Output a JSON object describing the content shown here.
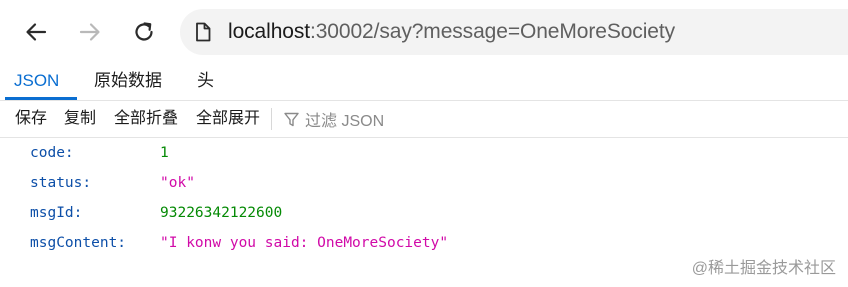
{
  "browser": {
    "back_icon": "arrow-left-icon",
    "forward_icon": "arrow-right-icon",
    "reload_icon": "reload-icon",
    "page_icon": "page-icon",
    "url_host": "localhost",
    "url_rest": ":30002/say?message=OneMoreSociety"
  },
  "viewer": {
    "tabs": [
      {
        "label": "JSON",
        "active": true
      },
      {
        "label": "原始数据",
        "active": false
      },
      {
        "label": "头",
        "active": false
      }
    ],
    "actions": {
      "save": "保存",
      "copy": "复制",
      "collapse_all": "全部折叠",
      "expand_all": "全部展开",
      "filter_placeholder": "过滤 JSON",
      "filter_icon": "filter-icon"
    },
    "rows": [
      {
        "key": "code:",
        "value": "1",
        "type": "number"
      },
      {
        "key": "status:",
        "value": "\"ok\"",
        "type": "string"
      },
      {
        "key": "msgId:",
        "value": "93226342122600",
        "type": "number"
      },
      {
        "key": "msgContent:",
        "value": "\"I konw you said: OneMoreSociety\"",
        "type": "string"
      }
    ]
  },
  "colors": {
    "accent": "#0a6ed1",
    "json_key": "#0d4fa8",
    "json_number": "#058a05",
    "json_string": "#d10aa8"
  },
  "watermark": "@稀土掘金技术社区"
}
